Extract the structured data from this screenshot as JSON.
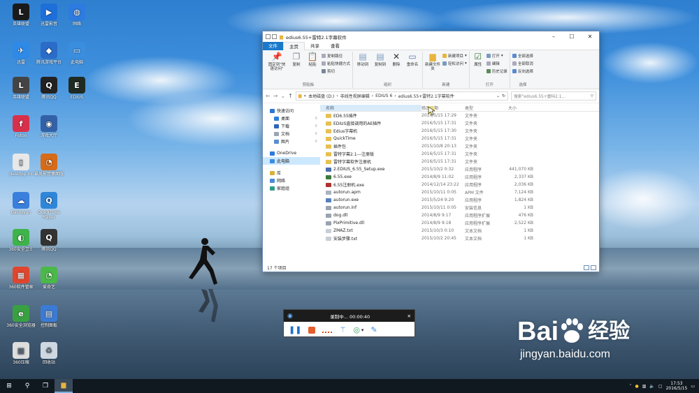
{
  "desktop_icons": [
    {
      "label": "英雄联盟",
      "color": "#1a1a1a",
      "glyph": "L"
    },
    {
      "label": "迅雷影音",
      "color": "#1e6fd9",
      "glyph": "▶"
    },
    {
      "label": "网络",
      "color": "#2d7be0",
      "glyph": "◍"
    },
    {
      "label": "迅雷",
      "color": "#2e8ae6",
      "glyph": "✈"
    },
    {
      "label": "腾讯游戏平台",
      "color": "#2a6cc8",
      "glyph": "◆"
    },
    {
      "label": "此电脑",
      "color": "#3a8ee0",
      "glyph": "▭"
    },
    {
      "label": "英雄联盟",
      "color": "#444",
      "glyph": "L"
    },
    {
      "label": "腾讯QQ",
      "color": "#222",
      "glyph": "Q"
    },
    {
      "label": "EDIUS",
      "color": "#1f2b22",
      "glyph": "E"
    },
    {
      "label": "Fotoo",
      "color": "#d8304a",
      "glyph": "f"
    },
    {
      "label": "游戏大厅",
      "color": "#3361a8",
      "glyph": "◉"
    },
    {
      "label": "desktop.ini",
      "color": "#e8e8e8",
      "glyph": "▯"
    },
    {
      "label": "暴风影音桌面版",
      "color": "#d66b18",
      "glyph": "◔"
    },
    {
      "label": "Baiduyun",
      "color": "#3a7fdc",
      "glyph": "☁"
    },
    {
      "label": "QuickTime Player",
      "color": "#2f86d8",
      "glyph": "Q"
    },
    {
      "label": "360安全卫士",
      "color": "#3db34a",
      "glyph": "◐"
    },
    {
      "label": "腾讯QQ",
      "color": "#333",
      "glyph": "Q"
    },
    {
      "label": "360软件管家",
      "color": "#e0462d",
      "glyph": "▦"
    },
    {
      "label": "爱奇艺",
      "color": "#4bb84a",
      "glyph": "◔"
    },
    {
      "label": "360安全浏览器",
      "color": "#39a042",
      "glyph": "e"
    },
    {
      "label": "控制面板",
      "color": "#3b7bd4",
      "glyph": "▤"
    },
    {
      "label": "360压缩",
      "color": "#ddd",
      "glyph": "▦"
    },
    {
      "label": "回收站",
      "color": "#cfd8e0",
      "glyph": "♻"
    }
  ],
  "explorer": {
    "title": "edius6.55+雷特2.1字幕软件",
    "ribbon_tabs": [
      "文件",
      "主页",
      "共享",
      "查看"
    ],
    "ribbon": {
      "pin": "固定到\"快速访问\"",
      "copy": "复制",
      "paste": "粘贴",
      "copy_path": "复制路径",
      "paste_shortcut": "粘贴快捷方式",
      "cut": "剪切",
      "clipboard": "剪贴板",
      "move_to": "移动到",
      "copy_to": "复制到",
      "delete": "删除",
      "rename": "重命名",
      "organize": "组织",
      "new_folder": "新建文件夹",
      "new_item": "新建项目",
      "easy_access": "轻松访问",
      "new": "新建",
      "properties": "属性",
      "open": "打开",
      "edit": "编辑",
      "history": "历史记录",
      "open_group": "打开",
      "select_all": "全部选择",
      "select_none": "全部取消",
      "invert": "反向选择",
      "select_group": "选择"
    },
    "path": [
      "本地磁盘 (D:)",
      "非线性视屏编辑",
      "EDIUS 6",
      "edius6.55+雷特2.1字幕软件"
    ],
    "search_placeholder": "搜索\"edius6.55+雷特2.1...",
    "nav": [
      {
        "label": "快速访问",
        "color": "#2b77d4"
      },
      {
        "label": "桌面",
        "color": "#2d7fd6",
        "pin": true
      },
      {
        "label": "下载",
        "color": "#2d66b6",
        "pin": true
      },
      {
        "label": "文档",
        "color": "#9aa6b2",
        "pin": true
      },
      {
        "label": "图片",
        "color": "#5c8ecf",
        "pin": true
      },
      {
        "label": "OneDrive",
        "color": "#2a7be0"
      },
      {
        "label": "此电脑",
        "color": "#3a8ee0",
        "selected": true
      },
      {
        "label": "库",
        "color": "#d9b13a"
      },
      {
        "label": "网络",
        "color": "#4a8ad8"
      },
      {
        "label": "家庭组",
        "color": "#2f9b8a"
      }
    ],
    "columns": [
      "名称",
      "修改日期",
      "类型",
      "大小"
    ],
    "files": [
      {
        "name": "ED6.55插件",
        "date": "2016/5/15 17:29",
        "type": "文件夹",
        "size": "",
        "color": "#e8c050"
      },
      {
        "name": "EDIUS直接调用的AE插件",
        "date": "2016/5/15 17:31",
        "type": "文件夹",
        "size": "",
        "color": "#e8c050"
      },
      {
        "name": "Edius字幕机",
        "date": "2016/5/15 17:30",
        "type": "文件夹",
        "size": "",
        "color": "#e8c050"
      },
      {
        "name": "QuickTime",
        "date": "2016/5/15 17:31",
        "type": "文件夹",
        "size": "",
        "color": "#e8c050"
      },
      {
        "name": "插件包",
        "date": "2015/10/8 20:13",
        "type": "文件夹",
        "size": "",
        "color": "#e8c050"
      },
      {
        "name": "雷特字幕2.1---注册版",
        "date": "2016/5/15 17:31",
        "type": "文件夹",
        "size": "",
        "color": "#e8c050"
      },
      {
        "name": "雷特字幕软件注册机",
        "date": "2016/5/15 17:31",
        "type": "文件夹",
        "size": "",
        "color": "#e8c050"
      },
      {
        "name": "2.EDIUS_6.55_Setup.exe",
        "date": "2015/10/2 0:32",
        "type": "应用程序",
        "size": "441,070 KB",
        "color": "#4a6fb0"
      },
      {
        "name": "6.55.exe",
        "date": "2014/8/9 11:02",
        "type": "应用程序",
        "size": "2,337 KB",
        "color": "#3b7a3b"
      },
      {
        "name": "6.55注册机.exe",
        "date": "2014/12/14 23:22",
        "type": "应用程序",
        "size": "2,036 KB",
        "color": "#b03030"
      },
      {
        "name": "autorun.apm",
        "date": "2015/10/11 0:05",
        "type": "APM 文件",
        "size": "7,124 KB",
        "color": "#aab4c0"
      },
      {
        "name": "autorun.exe",
        "date": "2015/5/24 9:20",
        "type": "应用程序",
        "size": "1,824 KB",
        "color": "#5580c0"
      },
      {
        "name": "autorun.inf",
        "date": "2015/10/11 0:05",
        "type": "安装信息",
        "size": "1 KB",
        "color": "#9aa4b0"
      },
      {
        "name": "dog.dll",
        "date": "2014/8/9 9:17",
        "type": "应用程序扩展",
        "size": "476 KB",
        "color": "#9aa4b0"
      },
      {
        "name": "PixPrimitive.dll",
        "date": "2014/8/9 9:18",
        "type": "应用程序扩展",
        "size": "2,522 KB",
        "color": "#9aa4b0"
      },
      {
        "name": "ZMAZ.txt",
        "date": "2015/10/3 0:10",
        "type": "文本文档",
        "size": "1 KB",
        "color": "#c8ced6"
      },
      {
        "name": "安装步骤.txt",
        "date": "2015/10/2 20:45",
        "type": "文本文档",
        "size": "1 KB",
        "color": "#c8ced6"
      }
    ],
    "status": "17 个项目"
  },
  "recorder": {
    "status": "录制中... 00:00:40"
  },
  "taskbar": {
    "time": "17:53",
    "date": "2016/5/15"
  },
  "watermark": {
    "brand": "Bai",
    "brand2": "经验",
    "url": "jingyan.baidu.com"
  }
}
